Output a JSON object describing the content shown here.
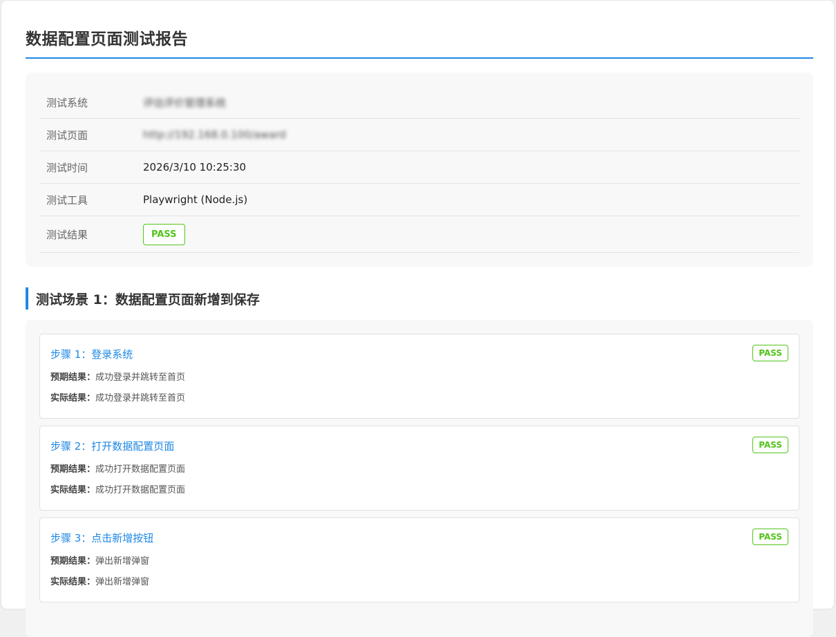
{
  "report": {
    "title": "数据配置页面测试报告"
  },
  "info": [
    {
      "label": "测试系统",
      "value": "评估评价管理系统",
      "blurred": true
    },
    {
      "label": "测试页面",
      "value": "http://192.168.0.100/award",
      "blurred": true
    },
    {
      "label": "测试时间",
      "value": "2026/3/10 10:25:30",
      "blurred": false
    },
    {
      "label": "测试工具",
      "value": "Playwright (Node.js)",
      "blurred": false
    }
  ],
  "result": {
    "label": "测试结果",
    "status": "PASS"
  },
  "scenario": {
    "title": "测试场景 1：数据配置页面新增到保存",
    "expected_label": "预期结果：",
    "actual_label": "实际结果：",
    "steps": [
      {
        "title": "步骤 1：登录系统",
        "status": "PASS",
        "expected": "成功登录并跳转至首页",
        "actual": "成功登录并跳转至首页"
      },
      {
        "title": "步骤 2：打开数据配置页面",
        "status": "PASS",
        "expected": "成功打开数据配置页面",
        "actual": "成功打开数据配置页面"
      },
      {
        "title": "步骤 3：点击新增按钮",
        "status": "PASS",
        "expected": "弹出新增弹窗",
        "actual": "弹出新增弹窗"
      }
    ]
  },
  "colors": {
    "accent": "#1e88e5",
    "pass": "#52c41a"
  }
}
